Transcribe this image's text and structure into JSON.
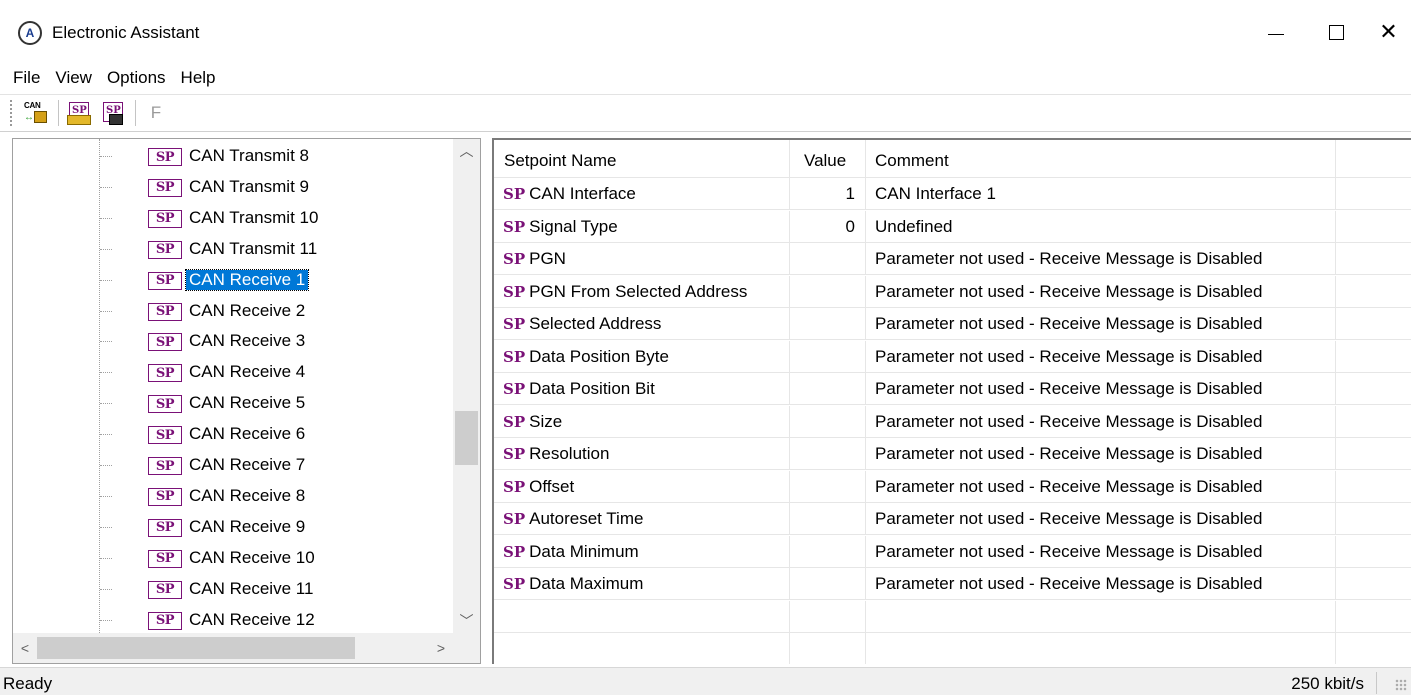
{
  "window": {
    "title": "Electronic Assistant",
    "controls": {
      "minimize": "—",
      "maximize": "☐",
      "close": "✕"
    }
  },
  "menu": [
    "File",
    "View",
    "Options",
    "Help"
  ],
  "toolbar": {
    "can_label": "CAN",
    "sp_label": "SP",
    "f_label": "F"
  },
  "tree": {
    "badge": "SP",
    "items": [
      "CAN Transmit 8",
      "CAN Transmit 9",
      "CAN Transmit 10",
      "CAN Transmit 11",
      "CAN Receive 1",
      "CAN Receive 2",
      "CAN Receive 3",
      "CAN Receive 4",
      "CAN Receive 5",
      "CAN Receive 6",
      "CAN Receive 7",
      "CAN Receive 8",
      "CAN Receive 9",
      "CAN Receive 10",
      "CAN Receive 11",
      "CAN Receive 12"
    ],
    "selected": "CAN Receive 1"
  },
  "grid": {
    "columns": [
      "Setpoint Name",
      "Value",
      "Comment"
    ],
    "prefix": "SP",
    "rows": [
      {
        "name": "CAN Interface",
        "value": "1",
        "comment": "CAN Interface 1"
      },
      {
        "name": "Signal Type",
        "value": "0",
        "comment": "Undefined"
      },
      {
        "name": "PGN",
        "value": "",
        "comment": "Parameter not used - Receive Message is Disabled"
      },
      {
        "name": "PGN From Selected Address",
        "value": "",
        "comment": "Parameter not used - Receive Message is Disabled"
      },
      {
        "name": "Selected Address",
        "value": "",
        "comment": "Parameter not used - Receive Message is Disabled"
      },
      {
        "name": "Data Position Byte",
        "value": "",
        "comment": "Parameter not used - Receive Message is Disabled"
      },
      {
        "name": "Data Position Bit",
        "value": "",
        "comment": "Parameter not used - Receive Message is Disabled"
      },
      {
        "name": "Size",
        "value": "",
        "comment": "Parameter not used - Receive Message is Disabled"
      },
      {
        "name": "Resolution",
        "value": "",
        "comment": "Parameter not used - Receive Message is Disabled"
      },
      {
        "name": "Offset",
        "value": "",
        "comment": "Parameter not used - Receive Message is Disabled"
      },
      {
        "name": "Autoreset Time",
        "value": "",
        "comment": "Parameter not used - Receive Message is Disabled"
      },
      {
        "name": "Data Minimum",
        "value": "",
        "comment": "Parameter not used - Receive Message is Disabled"
      },
      {
        "name": "Data Maximum",
        "value": "",
        "comment": "Parameter not used - Receive Message is Disabled"
      }
    ]
  },
  "status": {
    "text": "Ready",
    "rate": "250 kbit/s"
  }
}
